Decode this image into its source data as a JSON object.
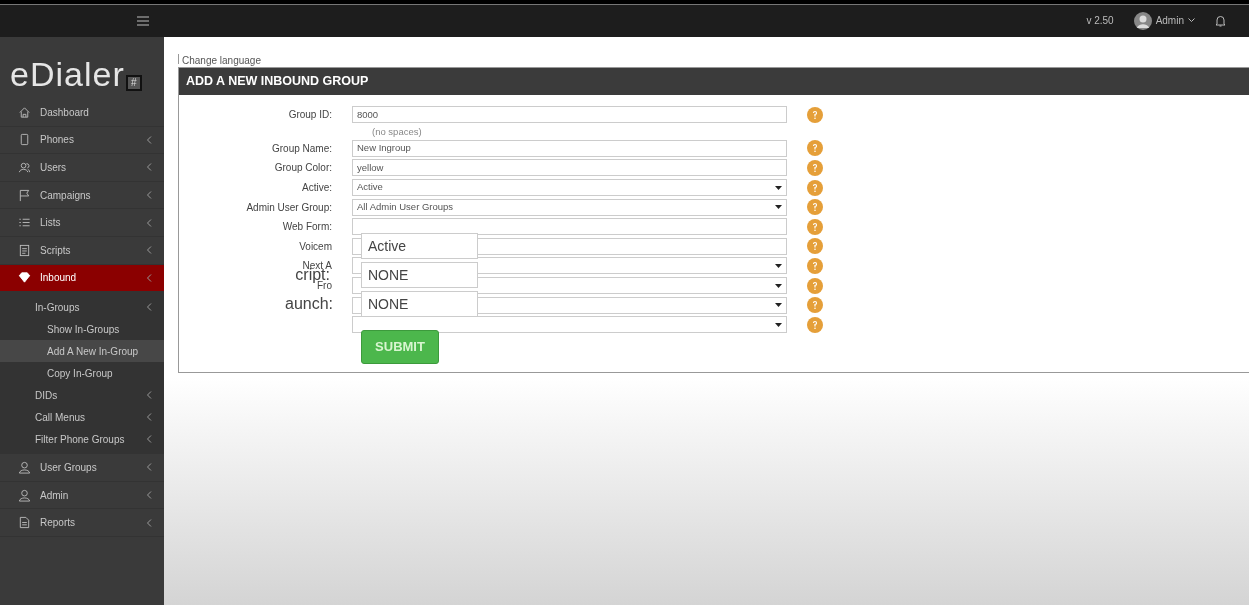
{
  "topbar": {
    "version": "v 2.50",
    "user": "Admin"
  },
  "logo": {
    "text": "eDialer",
    "badge": "#"
  },
  "sidebar": {
    "items": [
      {
        "label": "Dashboard",
        "kind": "home",
        "chevron": false,
        "selected": false
      },
      {
        "label": "Phones",
        "kind": "phone",
        "chevron": true,
        "selected": false
      },
      {
        "label": "Users",
        "kind": "users",
        "chevron": true,
        "selected": false
      },
      {
        "label": "Campaigns",
        "kind": "flag",
        "chevron": true,
        "selected": false
      },
      {
        "label": "Lists",
        "kind": "list",
        "chevron": true,
        "selected": false
      },
      {
        "label": "Scripts",
        "kind": "script",
        "chevron": true,
        "selected": false
      },
      {
        "label": "Inbound",
        "kind": "diamond",
        "chevron": true,
        "selected": true,
        "children": [
          {
            "label": "In-Groups",
            "chevron": true,
            "selected": false,
            "children": [
              {
                "label": "Show In-Groups",
                "selected": false
              },
              {
                "label": "Add A New In-Group",
                "selected": true
              },
              {
                "label": "Copy In-Group",
                "selected": false
              }
            ]
          },
          {
            "label": "DIDs",
            "chevron": true,
            "selected": false
          },
          {
            "label": "Call Menus",
            "chevron": true,
            "selected": false
          },
          {
            "label": "Filter Phone Groups",
            "chevron": true,
            "selected": false
          }
        ]
      },
      {
        "label": "User Groups",
        "kind": "user",
        "chevron": true,
        "selected": false
      },
      {
        "label": "Admin",
        "kind": "user",
        "chevron": true,
        "selected": false
      },
      {
        "label": "Reports",
        "kind": "file",
        "chevron": true,
        "selected": false
      }
    ]
  },
  "change_language": "Change language",
  "form": {
    "title": "ADD A NEW INBOUND GROUP",
    "rows": [
      {
        "label": "Group ID:",
        "kind": "input",
        "value": "8000",
        "hint": "(no spaces)"
      },
      {
        "label": "Group Name:",
        "kind": "input",
        "value": "New Ingroup"
      },
      {
        "label": "Group Color:",
        "kind": "input",
        "value": "yellow"
      },
      {
        "label": "Active:",
        "kind": "select",
        "value": "Active"
      },
      {
        "label": "Admin User Group:",
        "kind": "select",
        "value": "All Admin User Groups"
      },
      {
        "label": "Web Form:",
        "kind": "input"
      },
      {
        "label": "Voicem",
        "kind": "input"
      },
      {
        "label": "Next A",
        "kind": "select"
      },
      {
        "label": "Fro",
        "kind": "select"
      },
      {
        "kind": "select"
      },
      {
        "kind": "select"
      }
    ],
    "overlay": {
      "fields": [
        {
          "value": "Active"
        },
        {
          "label": "cript:",
          "value": "NONE"
        },
        {
          "label": "aunch:",
          "value": "NONE"
        }
      ],
      "submit": "SUBMIT"
    }
  }
}
